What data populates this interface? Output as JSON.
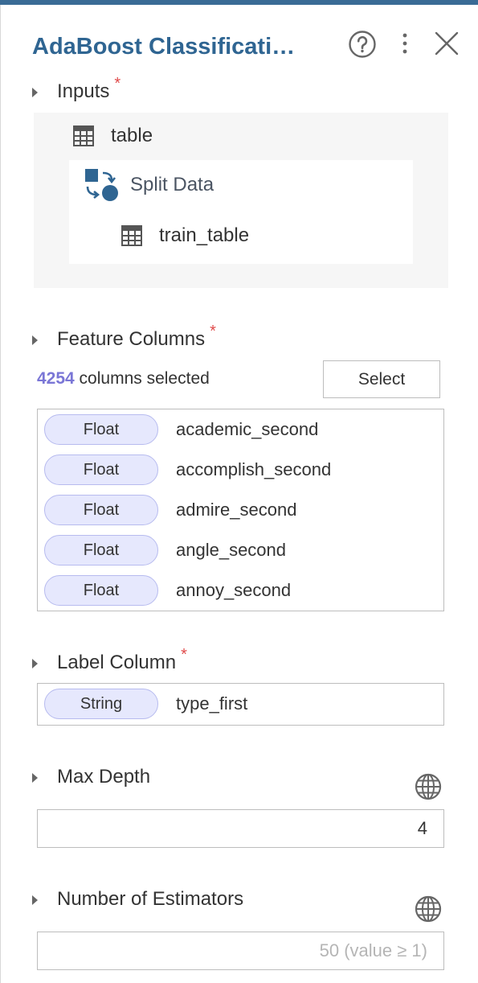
{
  "panel": {
    "title": "AdaBoost Classificati…"
  },
  "header_icons": [
    "help-circle-icon",
    "more-vertical-icon",
    "close-icon"
  ],
  "inputs": {
    "label": "Inputs",
    "required_mark": "*",
    "source_table": "table",
    "operator": "Split Data",
    "output_table": "train_table"
  },
  "feature_columns": {
    "label": "Feature Columns",
    "required_mark": "*",
    "selected_count": "4254",
    "selected_suffix": " columns selected",
    "select_button": "Select",
    "columns": [
      {
        "type": "Float",
        "name": "academic_second"
      },
      {
        "type": "Float",
        "name": "accomplish_second"
      },
      {
        "type": "Float",
        "name": "admire_second"
      },
      {
        "type": "Float",
        "name": "angle_second"
      },
      {
        "type": "Float",
        "name": "annoy_second"
      }
    ]
  },
  "label_column": {
    "label": "Label Column",
    "required_mark": "*",
    "type": "String",
    "name": "type_first"
  },
  "max_depth": {
    "label": "Max Depth",
    "value": "4"
  },
  "num_estimators": {
    "label": "Number of Estimators",
    "value": "",
    "placeholder": "50 (value ≥ 1)"
  },
  "colors": {
    "accent": "#2f6592",
    "topbar": "#3a6b95",
    "required": "#e04b4b",
    "count": "#7a76d6",
    "pill_bg": "#e6e8fd",
    "pill_border": "#b7bbef"
  }
}
